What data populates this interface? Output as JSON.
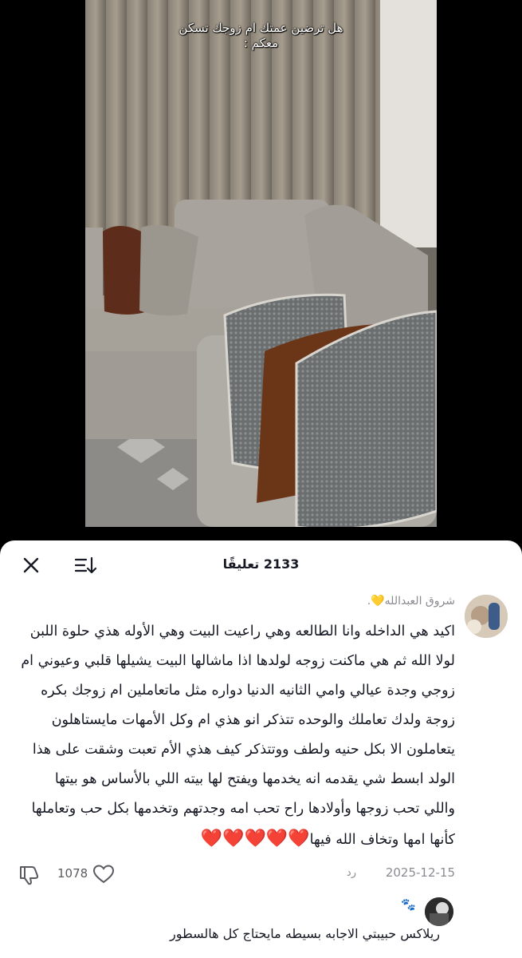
{
  "video": {
    "caption_line1": "هل ترضين عمتك ام زوجك تسكن",
    "caption_line2": "معكم :"
  },
  "comments_panel": {
    "title": "2133 تعليقًا",
    "close_icon": "close-icon",
    "sort_icon": "sort-icon"
  },
  "comments": [
    {
      "username": "شروق العبدالله💛.",
      "text": "اكيد هي الداخله وانا الطالعه وهي راعيت البيت وهي الأوله هذي حلوة اللبن لولا الله ثم هي ماكنت زوجه لولدها اذا ماشالها البيت يشيلها قلبي وعيوني ام زوجي وجدة عيالي وامي الثانيه الدنيا دواره مثل ماتعاملين ام زوجك بكره زوجة ولدك تعاملك والوحده تتذكر انو هذي ام وكل الأمهات مايستاهلون يتعاملون الا بكل حنيه ولطف ووتتذكر كيف هذي الأم تعبت وشقت على هذا الولد ابسط شي يقدمه انه يخدمها ويفتح لها بيته اللي بالأساس هو بيتها واللي تحب زوجها وأولادها راح تحب امه وجدتهم وتخدمها بكل حب وتعاملها كأنها امها وتخاف الله فيها",
      "hearts": "❤️❤️❤️❤️❤️",
      "date": "2025-12-15",
      "reply_label": "رد",
      "likes": "1078"
    },
    {
      "username": "🐾",
      "text": "ريلاكس حبيبتي الاجابه بسيطه مايحتاج كل هالسطور"
    }
  ],
  "colors": {
    "accent_heart": "#d8232a",
    "text_primary": "#161823",
    "text_secondary": "#8a8b91"
  }
}
